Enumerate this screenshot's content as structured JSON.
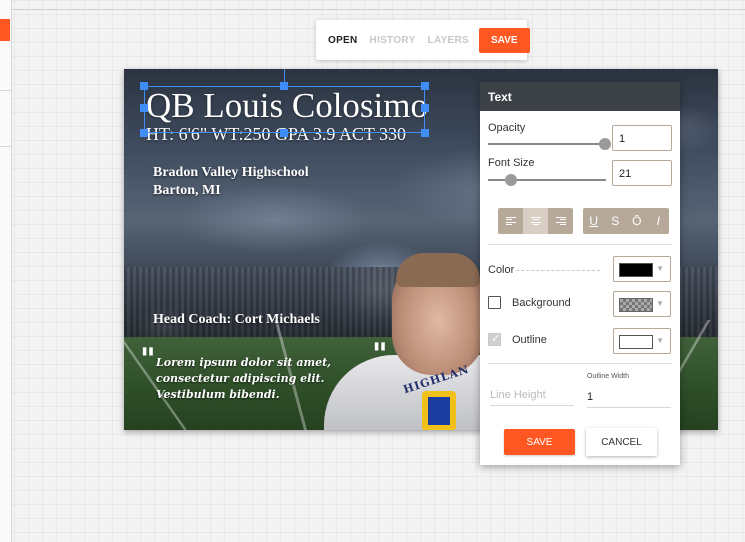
{
  "toolbar": {
    "open_label": "OPEN",
    "history_label": "HISTORY",
    "layers_label": "LAYERS",
    "save_label": "SAVE"
  },
  "canvas": {
    "title": "QB Louis Colosimo",
    "subtitle": "HT: 6'6\" WT:250 GPA 3.9 ACT 330",
    "school_line1": "Bradon Valley Highschool",
    "school_line2": "Barton, MI",
    "coach": "Head Coach: Cort Michaels",
    "quote": "Lorem ipsum dolor sit amet, consectetur adipiscing elit. Vestibulum bibendi.",
    "jersey_text": "HIGHLAN"
  },
  "panel": {
    "title": "Text",
    "opacity_label": "Opacity",
    "opacity_value": "1",
    "opacity_fraction": 1.0,
    "font_size_label": "Font Size",
    "font_size_value": "21",
    "font_size_slider_fraction": 0.2,
    "align_active": "center",
    "style_buttons": [
      "U",
      "S",
      "Ō",
      "I"
    ],
    "color_label": "Color",
    "color_value": "#000000",
    "background_label": "Background",
    "background_checked": false,
    "outline_label": "Outline",
    "outline_checked": true,
    "outline_color": "#ffffff",
    "line_height_placeholder": "Line Height",
    "outline_width_label": "Outline Width",
    "outline_width_value": "1",
    "save_label": "SAVE",
    "cancel_label": "CANCEL"
  },
  "colors": {
    "accent": "#ff5722",
    "panel_header": "#3b4146",
    "selection": "#3f8ef7",
    "control_tan": "#b7a99a"
  }
}
